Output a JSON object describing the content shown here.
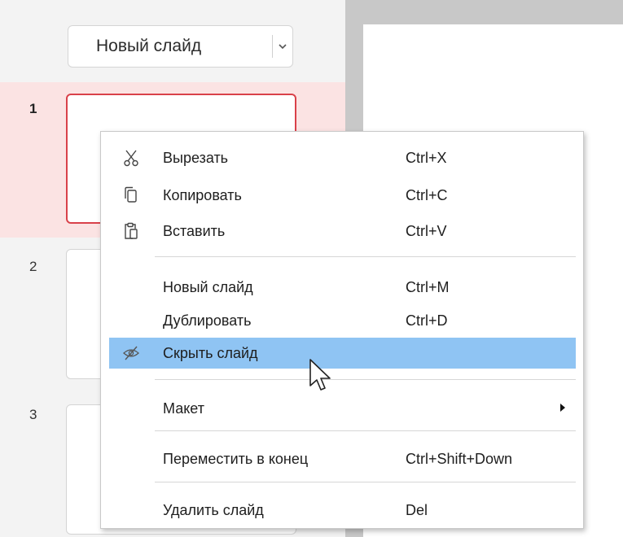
{
  "panel": {
    "new_slide_label": "Новый слайд",
    "slides": [
      {
        "number": "1",
        "selected": true
      },
      {
        "number": "2",
        "selected": false
      },
      {
        "number": "3",
        "selected": false
      }
    ]
  },
  "context_menu": {
    "items": [
      {
        "label": "Вырезать",
        "shortcut": "Ctrl+X",
        "icon": "scissors-icon"
      },
      {
        "label": "Копировать",
        "shortcut": "Ctrl+C",
        "icon": "copy-icon"
      },
      {
        "label": "Вставить",
        "shortcut": "Ctrl+V",
        "icon": "paste-icon"
      },
      {
        "label": "Новый слайд",
        "shortcut": "Ctrl+M"
      },
      {
        "label": "Дублировать",
        "shortcut": "Ctrl+D"
      },
      {
        "label": "Скрыть слайд",
        "shortcut": "",
        "icon": "eye-slash-icon",
        "highlighted": true
      },
      {
        "label": "Макет",
        "shortcut": "",
        "submenu": true
      },
      {
        "label": "Переместить в конец",
        "shortcut": "Ctrl+Shift+Down"
      },
      {
        "label": "Удалить слайд",
        "shortcut": "Del"
      }
    ]
  },
  "colors": {
    "selection_row": "#fbe3e3",
    "selected_border": "#d9414a",
    "menu_highlight": "#8fc4f3",
    "panel_bg": "#f3f3f3"
  }
}
